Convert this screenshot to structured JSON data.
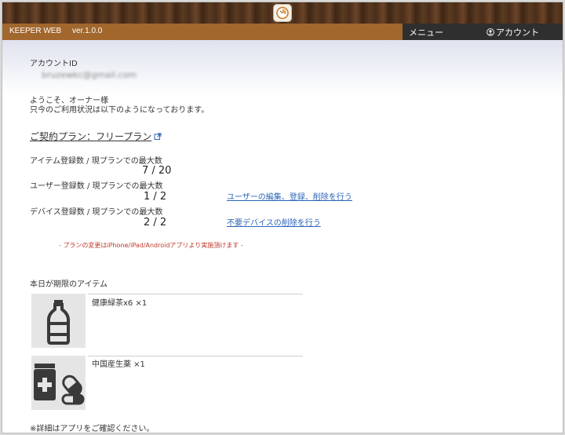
{
  "header": {
    "brand": "KEEPER WEB",
    "version": "ver.1.0.0",
    "menu_label": "メニュー",
    "account_label": "アカウント"
  },
  "account": {
    "id_label": "アカウントID",
    "email": "bruzewkc@gmail.com"
  },
  "welcome": {
    "line1": "ようこそ、オーナー様",
    "line2": "只今のご利用状況は以下のようになっております。"
  },
  "plan": {
    "label": "ご契約プラン：フリープラン"
  },
  "usage": {
    "items": {
      "label": "アイテム登録数 / 現プランでの最大数",
      "value": "7 / 20"
    },
    "users": {
      "label": "ユーザー登録数 / 現プランでの最大数",
      "value": "1 / 2",
      "link": "ユーザーの編集、登録、削除を行う"
    },
    "devices": {
      "label": "デバイス登録数 / 現プランでの最大数",
      "value": "2 / 2",
      "link": "不要デバイスの削除を行う"
    }
  },
  "notice": "- プランの変更はiPhone/iPad/Androidアプリより実施頂けます -",
  "today": {
    "title": "本日が期限のアイテム",
    "items": [
      {
        "name": "健康緑茶x6 ×1",
        "icon": "bottle-icon"
      },
      {
        "name": "中国産生薬 ×1",
        "icon": "medicine-icon"
      }
    ],
    "footer": "※詳細はアプリをご確認ください。"
  },
  "colors": {
    "nav_brown": "#a1672d",
    "nav_dark": "#2f2f2f",
    "link_blue": "#2a64b8",
    "notice_red": "#c0392b"
  }
}
